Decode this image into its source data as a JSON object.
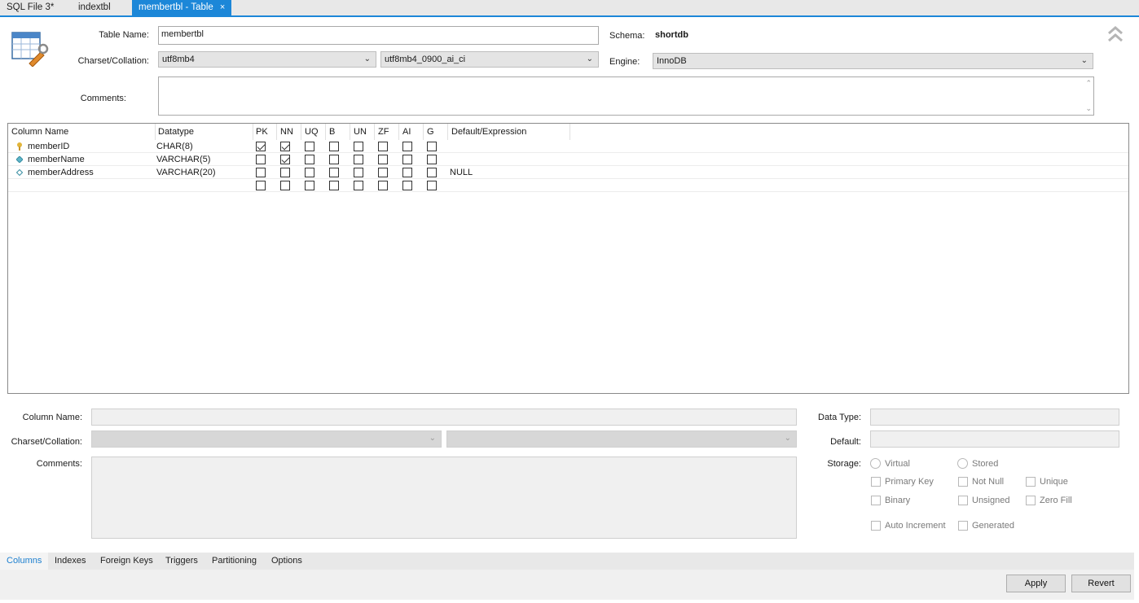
{
  "tabs": [
    {
      "label": "SQL File 3*"
    },
    {
      "label": "indextbl"
    },
    {
      "label": "membertbl - Table",
      "close": "×"
    }
  ],
  "table": {
    "name_label": "Table Name:",
    "name_value": "membertbl",
    "schema_label": "Schema:",
    "schema_value": "shortdb",
    "charset_label": "Charset/Collation:",
    "charset_value": "utf8mb4",
    "collation_value": "utf8mb4_0900_ai_ci",
    "engine_label": "Engine:",
    "engine_value": "InnoDB",
    "comments_label": "Comments:",
    "comments_value": "",
    "collapse_icon": "double-chevron-up-icon"
  },
  "columns_grid": {
    "headers": [
      "Column Name",
      "Datatype",
      "PK",
      "NN",
      "UQ",
      "B",
      "UN",
      "ZF",
      "AI",
      "G",
      "Default/Expression"
    ],
    "rows": [
      {
        "icon": "key-icon",
        "name": "memberID",
        "datatype": "CHAR(8)",
        "flags": [
          true,
          true,
          false,
          false,
          false,
          false,
          false,
          false
        ],
        "default": ""
      },
      {
        "icon": "filled-diamond-icon",
        "name": "memberName",
        "datatype": "VARCHAR(5)",
        "flags": [
          false,
          true,
          false,
          false,
          false,
          false,
          false,
          false
        ],
        "default": ""
      },
      {
        "icon": "hollow-diamond-icon",
        "name": "memberAddress",
        "datatype": "VARCHAR(20)",
        "flags": [
          false,
          false,
          false,
          false,
          false,
          false,
          false,
          false
        ],
        "default": "NULL"
      },
      {
        "icon": "",
        "name": "",
        "datatype": "",
        "flags": [
          false,
          false,
          false,
          false,
          false,
          false,
          false,
          false
        ],
        "default": ""
      }
    ]
  },
  "details": {
    "column_name_label": "Column Name:",
    "column_name_value": "",
    "charset_label": "Charset/Collation:",
    "comments_label": "Comments:",
    "data_type_label": "Data Type:",
    "default_label": "Default:",
    "storage_label": "Storage:",
    "options": {
      "virtual": "Virtual",
      "stored": "Stored",
      "primary_key": "Primary Key",
      "not_null": "Not Null",
      "unique": "Unique",
      "binary": "Binary",
      "unsigned": "Unsigned",
      "zero_fill": "Zero Fill",
      "auto_increment": "Auto Increment",
      "generated": "Generated"
    }
  },
  "bottom_tabs": [
    "Columns",
    "Indexes",
    "Foreign Keys",
    "Triggers",
    "Partitioning",
    "Options"
  ],
  "buttons": {
    "apply": "Apply",
    "revert": "Revert"
  },
  "colors": {
    "accent": "#1c87d8",
    "active_tab_text": "#1c7fcf"
  }
}
